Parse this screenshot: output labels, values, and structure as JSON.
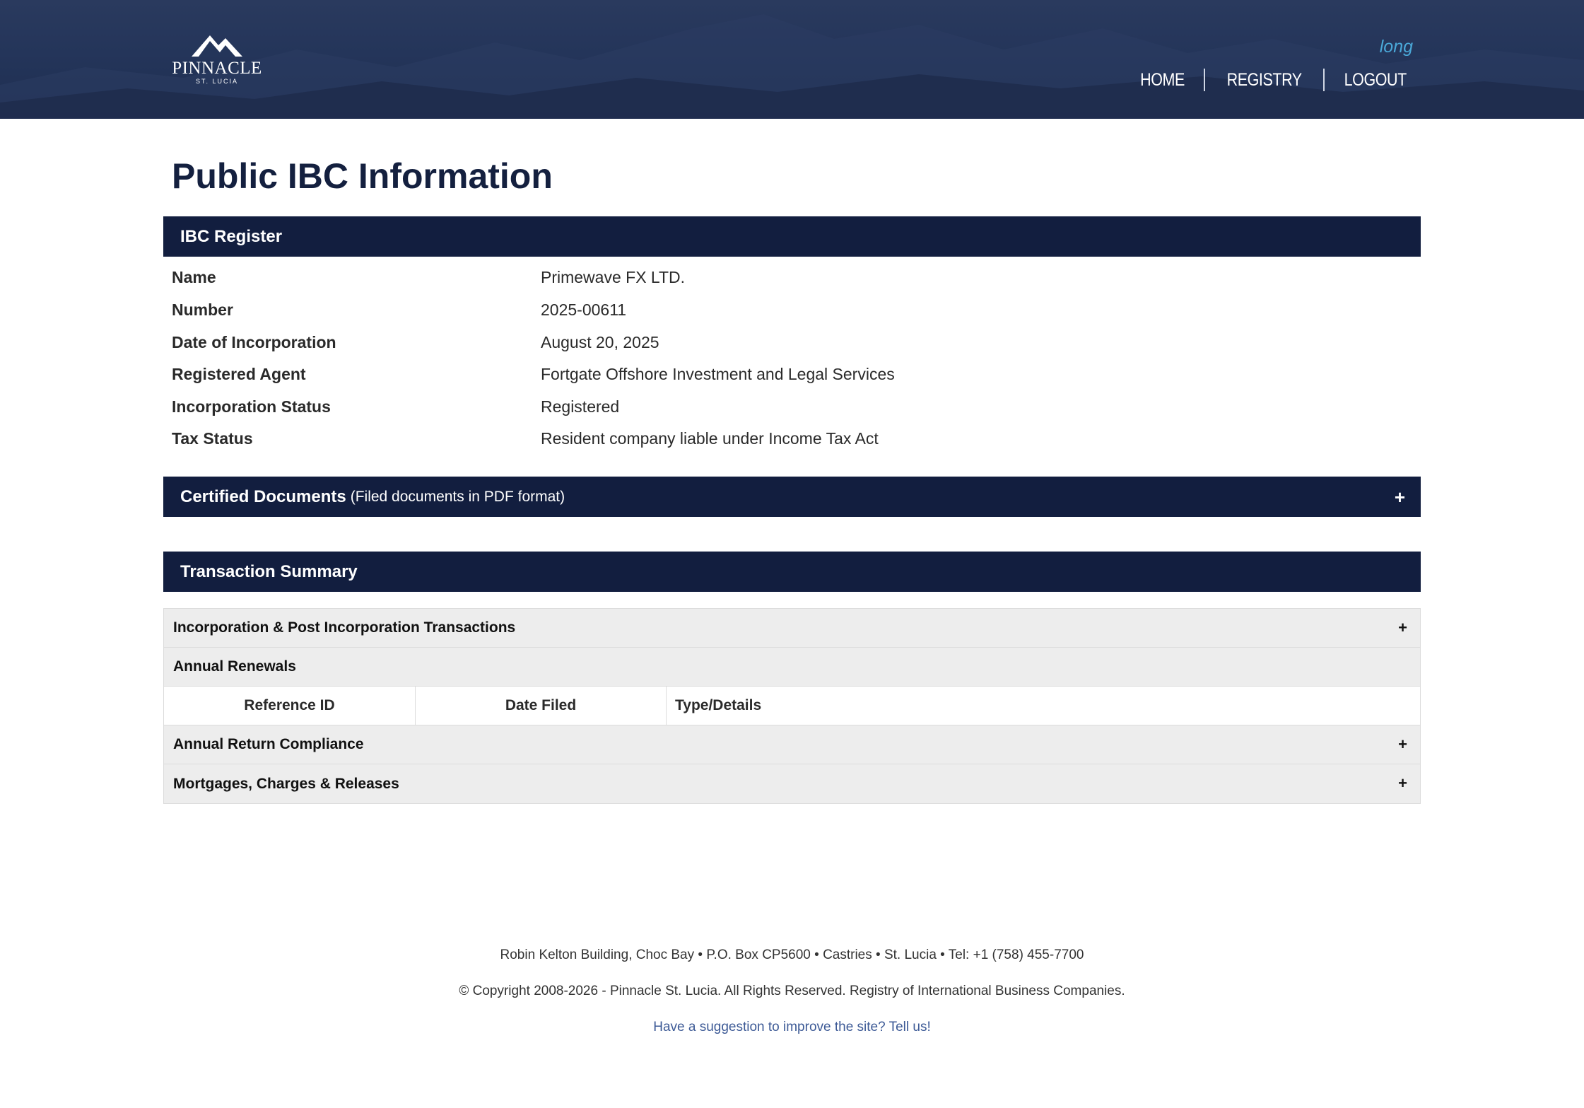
{
  "header": {
    "logo_text": "PINNACLE",
    "logo_subtext": "ST. LUCIA",
    "username": "long",
    "nav": [
      "HOME",
      "REGISTRY",
      "LOGOUT"
    ]
  },
  "page_title": "Public IBC Information",
  "ibc_register": {
    "heading": "IBC Register",
    "rows": [
      {
        "label": "Name",
        "value": "Primewave FX LTD."
      },
      {
        "label": "Number",
        "value": "2025-00611"
      },
      {
        "label": "Date of Incorporation",
        "value": "August 20, 2025"
      },
      {
        "label": "Registered Agent",
        "value": "Fortgate Offshore Investment and Legal Services"
      },
      {
        "label": "Incorporation Status",
        "value": "Registered"
      },
      {
        "label": "Tax Status",
        "value": "Resident company liable under Income Tax Act"
      }
    ]
  },
  "certified_documents": {
    "heading": "Certified Documents",
    "subheading": "(Filed documents in PDF format)",
    "toggle": "+"
  },
  "transaction_summary": {
    "heading": "Transaction Summary",
    "incorporation": {
      "label": "Incorporation & Post Incorporation Transactions",
      "toggle": "+"
    },
    "annual_renewals": {
      "label": "Annual Renewals"
    },
    "columns": [
      "Reference ID",
      "Date Filed",
      "Type/Details"
    ],
    "annual_return": {
      "label": "Annual Return Compliance",
      "toggle": "+"
    },
    "mortgages": {
      "label": "Mortgages, Charges & Releases",
      "toggle": "+"
    }
  },
  "footer": {
    "address": "Robin Kelton Building, Choc Bay • P.O. Box CP5600 • Castries • St. Lucia • Tel: +1 (758) 455-7700",
    "copyright": "© Copyright 2008-2026 - Pinnacle St. Lucia. All Rights Reserved. Registry of International Business Companies.",
    "suggestion_link": "Have a suggestion to improve the site? Tell us!"
  },
  "colors": {
    "header_bg": "#24355a",
    "bar_bg": "#121e3f",
    "title": "#14203f",
    "username": "#4aa8d8",
    "link": "#3d5a96",
    "row_bg": "#ededed"
  }
}
